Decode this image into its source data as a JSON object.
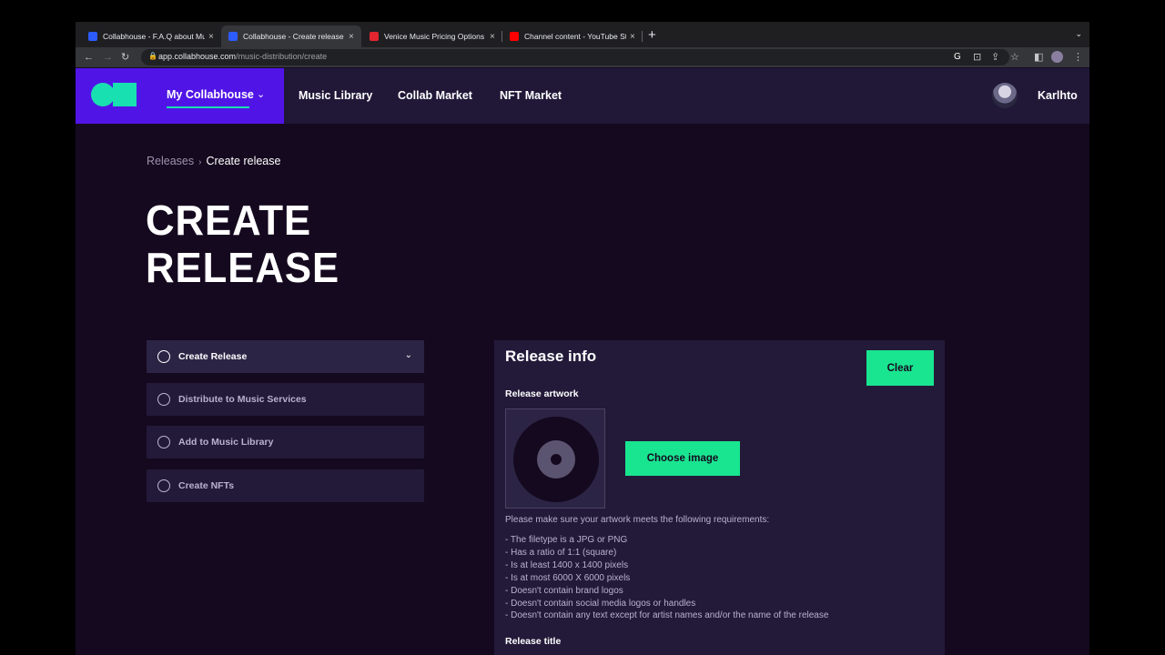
{
  "browser": {
    "tabs": [
      {
        "title": "Collabhouse - F.A.Q about Mu",
        "active": false,
        "favicon_color": "#2c5bff"
      },
      {
        "title": "Collabhouse - Create release",
        "active": true,
        "favicon_color": "#2c5bff"
      },
      {
        "title": "Venice Music Pricing Options",
        "active": false,
        "favicon_color": "#e3262f"
      },
      {
        "title": "Channel content - YouTube Stu",
        "active": false,
        "favicon_color": "#ff0000"
      }
    ],
    "close_glyph": "×",
    "new_tab_glyph": "+",
    "url_host": "app.collabhouse.com",
    "url_path": "/music-distribution/create"
  },
  "site": {
    "nav": {
      "my_collabhouse": "My Collabhouse",
      "music_library": "Music Library",
      "collab_market": "Collab Market",
      "nft_market": "NFT Market"
    },
    "user": {
      "name": "Karlhto"
    }
  },
  "breadcrumb": {
    "root": "Releases",
    "separator": "›",
    "current": "Create release"
  },
  "page": {
    "title_line1": "CREATE",
    "title_line2": "RELEASE"
  },
  "steps": [
    {
      "label": "Create Release",
      "active": true
    },
    {
      "label": "Distribute to Music Services",
      "active": false
    },
    {
      "label": "Add to Music Library",
      "active": false
    },
    {
      "label": "Create NFTs",
      "active": false
    }
  ],
  "release_info": {
    "title": "Release info",
    "clear_label": "Clear",
    "artwork_label": "Release artwork",
    "choose_image_label": "Choose image",
    "requirements_intro": "Please make sure your artwork meets the following requirements:",
    "requirements": [
      "- The filetype is a JPG or PNG",
      "- Has a ratio of 1:1 (square)",
      "- Is at least 1400 x 1400 pixels",
      "- Is at most 6000 X 6000 pixels",
      "- Doesn't contain brand logos",
      "- Doesn't contain social media logos or handles",
      "- Doesn't contain any text except for artist names and/or the name of the release"
    ],
    "release_title_label": "Release title"
  },
  "colors": {
    "brand_purple": "#5015e6",
    "accent_green": "#19e590",
    "logo_teal": "#19e0b0",
    "page_bg": "#15091f",
    "panel_bg": "#231a3a"
  }
}
